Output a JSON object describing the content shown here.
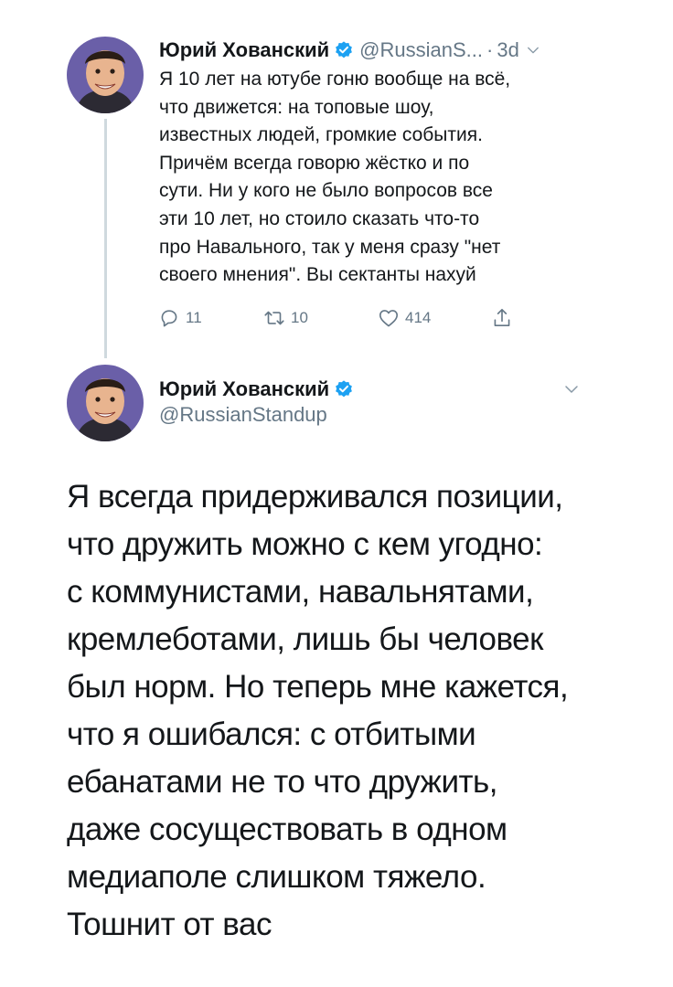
{
  "tweet1": {
    "author_name": "Юрий Хованский",
    "handle": "@RussianS...",
    "separator": "·",
    "time": "3d",
    "text": "Я 10 лет на ютубе гоню вообще на всё,\nчто движется: на топовые шоу,\nизвестных людей, громкие события.\nПричём всегда говорю жёстко и по\nсути. Ни у кого не было вопросов все\nэти 10 лет, но стоило сказать что-то\nпро Навального, так у меня сразу \"нет\nсвоего мнения\". Вы сектанты нахуй",
    "replies": "11",
    "retweets": "10",
    "likes": "414"
  },
  "tweet2": {
    "author_name": "Юрий Хованский",
    "handle": "@RussianStandup",
    "text": "Я всегда придерживался позиции,\nчто дружить можно с кем угодно:\nс коммунистами, навальнятами,\nкремлеботами, лишь бы человек\nбыл норм. Но теперь мне кажется,\nчто я ошибался: с отбитыми\nебанатами не то что дружить,\nдаже сосуществовать в одном\nмедиаполе слишком тяжело.\nТошнит от вас"
  },
  "icons": {
    "verified": "verified-badge-icon",
    "chevron": "chevron-down-icon",
    "reply": "reply-icon",
    "retweet": "retweet-icon",
    "like": "heart-icon",
    "share": "share-icon"
  },
  "colors": {
    "text": "#14171a",
    "secondary": "#657786",
    "verified": "#1da1f2",
    "thread_line": "#cfd9de",
    "avatar_background": "#6a5fa8"
  }
}
